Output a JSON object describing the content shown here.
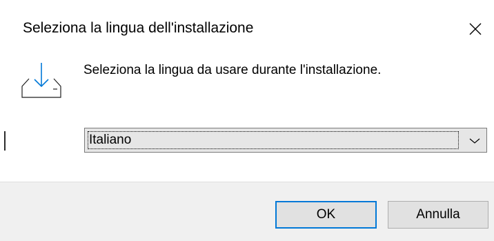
{
  "dialog": {
    "title": "Seleziona la lingua dell'installazione",
    "close_icon": "close-icon",
    "install_icon": "install-download-icon",
    "prompt": "Seleziona la lingua da usare durante l'installazione.",
    "language_select": {
      "selected_value": "Italiano",
      "arrow_icon": "chevron-down-icon"
    },
    "buttons": {
      "ok_label": "OK",
      "cancel_label": "Annulla"
    },
    "colors": {
      "focus_border": "#0078d7",
      "footer_bg": "#f0f0f0",
      "select_bg": "#e6e6e6"
    }
  }
}
